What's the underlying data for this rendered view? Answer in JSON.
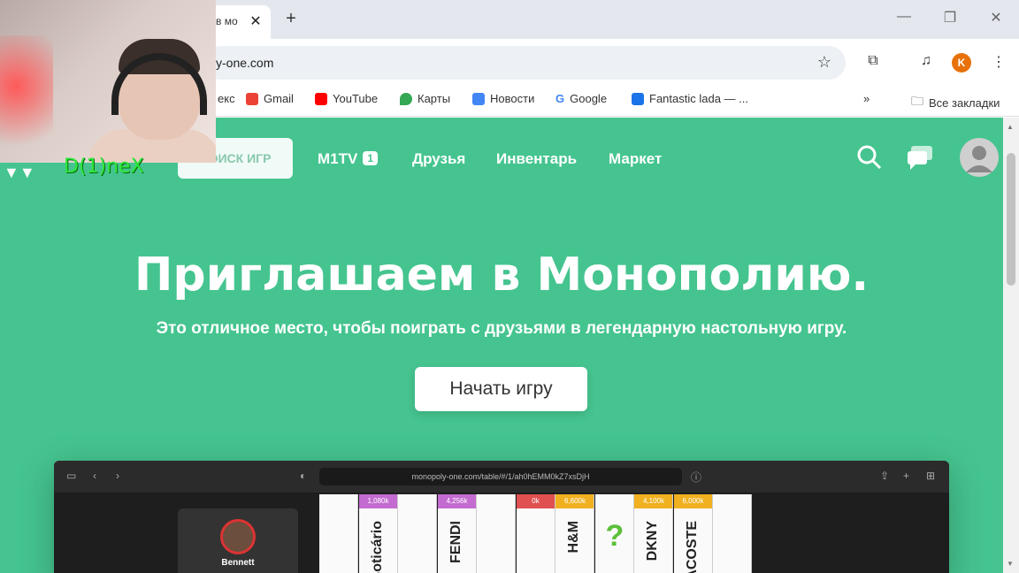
{
  "browser": {
    "tab_title": "в мо",
    "url": "y-one.com",
    "window_controls": [
      "—",
      "❐",
      "✕"
    ],
    "profile_initial": "K",
    "bookmarks": [
      {
        "label": "екс",
        "icon": "yandex-icon",
        "color": "#fc3f1d"
      },
      {
        "label": "Gmail",
        "icon": "gmail-icon",
        "color": "#ea4335"
      },
      {
        "label": "YouTube",
        "icon": "youtube-icon",
        "color": "#ff0000"
      },
      {
        "label": "Карты",
        "icon": "maps-icon",
        "color": "#34a853"
      },
      {
        "label": "Новости",
        "icon": "news-icon",
        "color": "#4285f4"
      },
      {
        "label": "Google",
        "icon": "google-icon",
        "color": "#4285f4"
      },
      {
        "label": "Fantastic lada — ...",
        "icon": "lada-icon",
        "color": "#1a73e8"
      }
    ],
    "more_bookmarks": "»",
    "all_bookmarks": "Все закладки"
  },
  "nav": {
    "search_games": "ПОИСК ИГР",
    "m1tv": "M1TV",
    "m1tv_badge": "1",
    "friends": "Друзья",
    "inventory": "Инвентарь",
    "market": "Маркет"
  },
  "hero": {
    "title": "Приглашаем в Монополию.",
    "subtitle": "Это отличное место, чтобы поиграть с друзьями в легендарную настольную игру.",
    "cta": "Начать игру"
  },
  "preview": {
    "url": "monopoly-one.com/table/#/1/ah0hEMM0kZ7xsDjH",
    "player_name": "Bennett",
    "cells": [
      {
        "price": "",
        "brand": "",
        "color": "#ffffff"
      },
      {
        "price": "1,080k",
        "brand": "oBoticário",
        "color": "#c36bd0"
      },
      {
        "price": "",
        "brand": "",
        "color": "#ffffff"
      },
      {
        "price": "4,256k",
        "brand": "FENDI",
        "color": "#c36bd0"
      },
      {
        "price": "",
        "brand": "",
        "color": "#ffffff"
      },
      {
        "price": "0k",
        "brand": "",
        "color": "#e05050"
      },
      {
        "price": "6,600k",
        "brand": "H&M",
        "color": "#f0b020"
      },
      {
        "price": "",
        "brand": "?",
        "color": "#ffffff"
      },
      {
        "price": "4,100k",
        "brand": "DKNY",
        "color": "#f0b020"
      },
      {
        "price": "6,000k",
        "brand": "LACOSTE",
        "color": "#f0b020"
      },
      {
        "price": "",
        "brand": "",
        "color": "#ffffff"
      }
    ]
  },
  "webcam": {
    "overlay_name": "D(1)neX"
  },
  "colors": {
    "page_bg": "#45c48f",
    "accent": "#ffffff"
  }
}
